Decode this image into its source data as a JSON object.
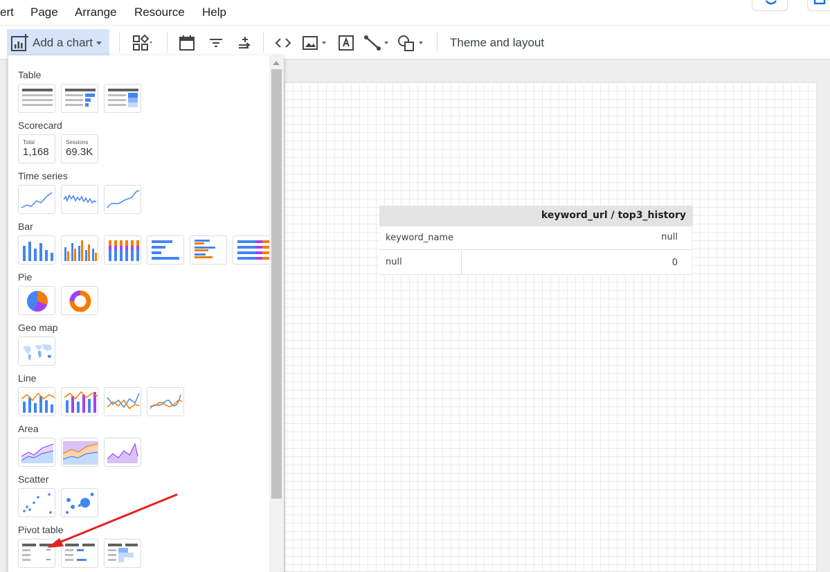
{
  "menubar": {
    "items": [
      "ert",
      "Page",
      "Arrange",
      "Resource",
      "Help"
    ]
  },
  "toolbar": {
    "add_chart_label": "Add a chart",
    "theme_layout_label": "Theme and layout"
  },
  "panel": {
    "sections": {
      "table": "Table",
      "scorecard": "Scorecard",
      "time_series": "Time series",
      "bar": "Bar",
      "pie": "Pie",
      "geo_map": "Geo map",
      "line": "Line",
      "area": "Area",
      "scatter": "Scatter",
      "pivot_table": "Pivot table"
    },
    "scorecards": [
      {
        "label": "Total",
        "value": "1,168"
      },
      {
        "label": "Sessions",
        "value": "69.3K"
      }
    ]
  },
  "pivot": {
    "header": "keyword_url / top3_history",
    "row_dim_label": "keyword_name",
    "col_value_label": "null",
    "row_value": "null",
    "cell_value": "0"
  },
  "colors": {
    "accent_blue": "#4285f4",
    "orange": "#f57c00",
    "purple": "#a142f4",
    "annotation_red": "#e8211d"
  }
}
